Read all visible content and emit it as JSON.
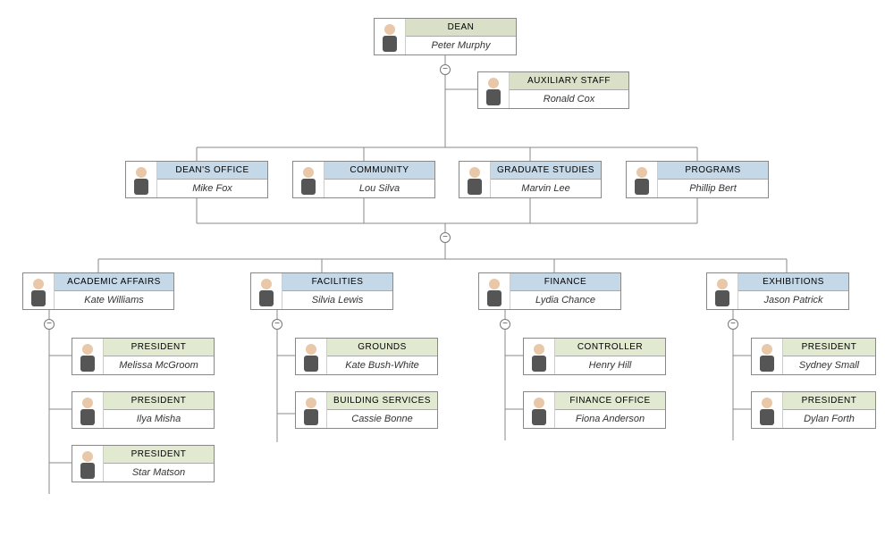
{
  "org": {
    "dean": {
      "title": "DEAN",
      "name": "Peter Murphy"
    },
    "aux": {
      "title": "AUXILIARY STAFF",
      "name": "Ronald Cox"
    },
    "deanoffice": {
      "title": "DEAN'S OFFICE",
      "name": "Mike Fox"
    },
    "community": {
      "title": "COMMUNITY",
      "name": "Lou Silva"
    },
    "grad": {
      "title": "GRADUATE STUDIES",
      "name": "Marvin Lee"
    },
    "programs": {
      "title": "PROGRAMS",
      "name": "Phillip Bert"
    },
    "academic": {
      "title": "ACADEMIC AFFAIRS",
      "name": "Kate Williams"
    },
    "facilities": {
      "title": "FACILITIES",
      "name": "Silvia Lewis"
    },
    "finance": {
      "title": "FINANCE",
      "name": "Lydia Chance"
    },
    "exhibitions": {
      "title": "EXHIBITIONS",
      "name": "Jason Patrick"
    },
    "pres1": {
      "title": "PRESIDENT",
      "name": "Melissa McGroom"
    },
    "pres2": {
      "title": "PRESIDENT",
      "name": "Ilya Misha"
    },
    "pres3": {
      "title": "PRESIDENT",
      "name": "Star Matson"
    },
    "grounds": {
      "title": "GROUNDS",
      "name": "Kate Bush-White"
    },
    "building": {
      "title": "BUILDING SERVICES",
      "name": "Cassie Bonne"
    },
    "controller": {
      "title": "CONTROLLER",
      "name": "Henry Hill"
    },
    "finoffice": {
      "title": "FINANCE OFFICE",
      "name": "Fiona Anderson"
    },
    "pres4": {
      "title": "PRESIDENT",
      "name": "Sydney Small"
    },
    "pres5": {
      "title": "PRESIDENT",
      "name": "Dylan Forth"
    },
    "toggle": "−"
  },
  "colors": {
    "blue": "#c5d8e8",
    "olive": "#d9e0c7",
    "green": "#e1ead0"
  }
}
